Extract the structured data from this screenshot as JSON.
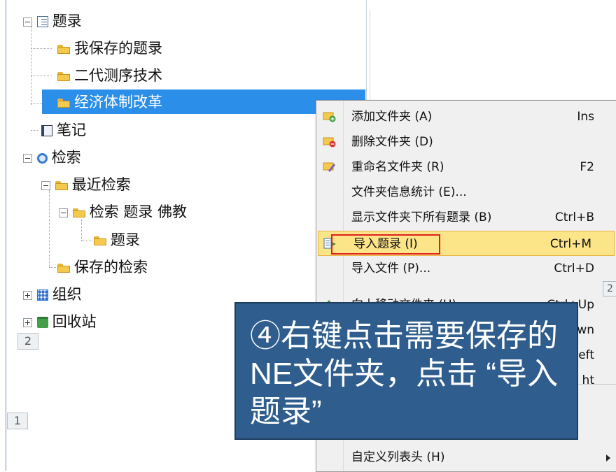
{
  "tree": {
    "items": [
      {
        "label": "题录",
        "icon": "list-icon",
        "expander": "minus"
      },
      {
        "label": "我保存的题录",
        "icon": "folder-icon"
      },
      {
        "label": "二代测序技术",
        "icon": "folder-icon"
      },
      {
        "label": "经济体制改革",
        "icon": "folder-icon",
        "selected": true
      },
      {
        "label": "笔记",
        "icon": "note-icon"
      },
      {
        "label": "检索",
        "icon": "search-icon",
        "expander": "minus"
      },
      {
        "label": "最近检索",
        "icon": "folder-icon",
        "expander": "minus"
      },
      {
        "label": "检索 题录 佛教",
        "icon": "folder-icon",
        "expander": "minus"
      },
      {
        "label": "题录",
        "icon": "folder-icon"
      },
      {
        "label": "保存的检索",
        "icon": "folder-icon"
      },
      {
        "label": "组织",
        "icon": "org-icon",
        "expander": "plus"
      },
      {
        "label": "回收站",
        "icon": "recycle-bin-icon",
        "expander": "plus"
      }
    ],
    "pager_a": "2",
    "pager_b": "1"
  },
  "menu": {
    "items": [
      {
        "label": "添加文件夹 (A)",
        "shortcut": "Ins",
        "icon": "add-folder-icon"
      },
      {
        "label": "删除文件夹 (D)",
        "shortcut": "",
        "icon": "delete-folder-icon"
      },
      {
        "label": "重命名文件夹 (R)",
        "shortcut": "F2",
        "icon": "rename-icon"
      },
      {
        "label": "文件夹信息统计 (E)...",
        "shortcut": ""
      },
      {
        "label": "显示文件夹下所有题录 (B)",
        "shortcut": "Ctrl+B"
      },
      {
        "label": "导入题录 (I)",
        "shortcut": "Ctrl+M",
        "icon": "import-icon",
        "highlighted": true
      },
      {
        "label": "导入文件 (P)...",
        "shortcut": "Ctrl+D"
      },
      {
        "label": "向上移动文件夹 (U)",
        "shortcut": "Ctrl+Up"
      },
      {
        "label": "",
        "shortcut": "wn"
      },
      {
        "label": "",
        "shortcut": "eft"
      },
      {
        "label": "",
        "shortcut": "ht"
      },
      {
        "label": "自定义列表头 (H)",
        "shortcut": ""
      }
    ],
    "scroll_label": "2"
  },
  "callout": {
    "text": "④右键点击需要保存的NE文件夹，点击 “导入题录”"
  },
  "colors": {
    "selection": "#2b8ee8",
    "highlight": "#fce489",
    "callout_bg": "#2f5e8e",
    "red_box": "#e02020"
  }
}
